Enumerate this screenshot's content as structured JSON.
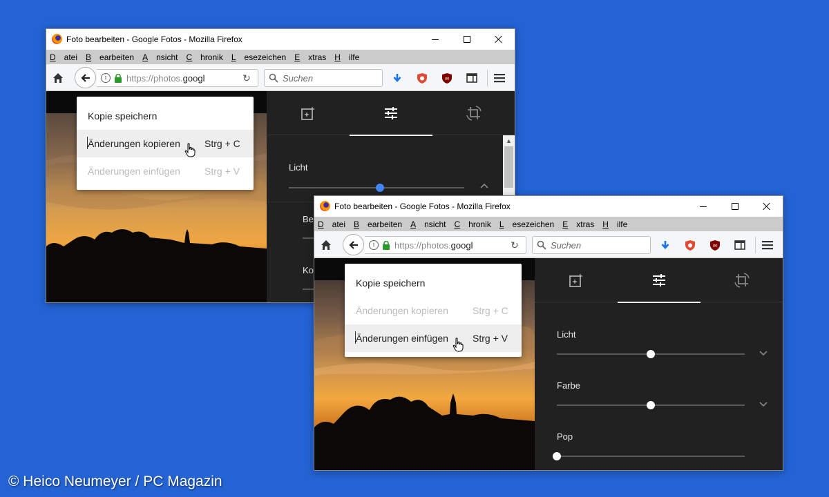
{
  "credit": "© Heico Neumeyer / PC Magazin",
  "window": {
    "title": "Foto bearbeiten - Google Fotos - Mozilla Firefox",
    "menus": [
      {
        "label": "Datei",
        "key": "D",
        "rest": "atei"
      },
      {
        "label": "Bearbeiten",
        "key": "B",
        "rest": "earbeiten"
      },
      {
        "label": "Ansicht",
        "key": "A",
        "rest": "nsicht"
      },
      {
        "label": "Chronik",
        "key": "C",
        "rest": "hronik"
      },
      {
        "label": "Lesezeichen",
        "key": "L",
        "rest": "esezeichen"
      },
      {
        "label": "Extras",
        "key": "E",
        "rest": "xtras"
      },
      {
        "label": "Hilfe",
        "key": "H",
        "rest": "ilfe"
      }
    ],
    "url_prefix": "https://photos.",
    "url_host": "googl",
    "search_placeholder": "Suchen"
  },
  "context_menu": {
    "items": [
      {
        "label": "Kopie speichern",
        "shortcut": ""
      },
      {
        "label": "Änderungen kopieren",
        "shortcut": "Strg + C"
      },
      {
        "label": "Änderungen einfügen",
        "shortcut": "Strg + V"
      }
    ]
  },
  "window1": {
    "highlighted_item": "Änderungen kopieren",
    "disabled_item": "Änderungen einfügen",
    "panel": {
      "licht_label": "Licht",
      "licht_value": 0.52,
      "cut_label_1": "Be",
      "cut_label_2": "Ko"
    }
  },
  "window2": {
    "highlighted_item": "Änderungen einfügen",
    "disabled_item": "Änderungen kopieren",
    "panel": {
      "sliders": [
        {
          "label": "Licht",
          "value": 0.5
        },
        {
          "label": "Farbe",
          "value": 0.5
        },
        {
          "label": "Pop",
          "value": 0.0
        }
      ]
    }
  },
  "colors": {
    "background": "#2463d4",
    "panel": "#212121",
    "active_slider": "#4285f4",
    "download_arrow": "#1a73e8",
    "ublock": "#800000"
  },
  "icons": [
    "firefox-logo-icon",
    "home-icon",
    "back-arrow-icon",
    "info-icon",
    "lock-icon",
    "reload-icon",
    "search-icon",
    "download-icon",
    "privacy-badger-icon",
    "ublock-origin-icon",
    "sidebar-icon",
    "hamburger-menu-icon",
    "auto-enhance-icon",
    "adjust-sliders-icon",
    "crop-rotate-icon",
    "chevron-up-icon",
    "chevron-down-icon",
    "hand-cursor-icon"
  ]
}
